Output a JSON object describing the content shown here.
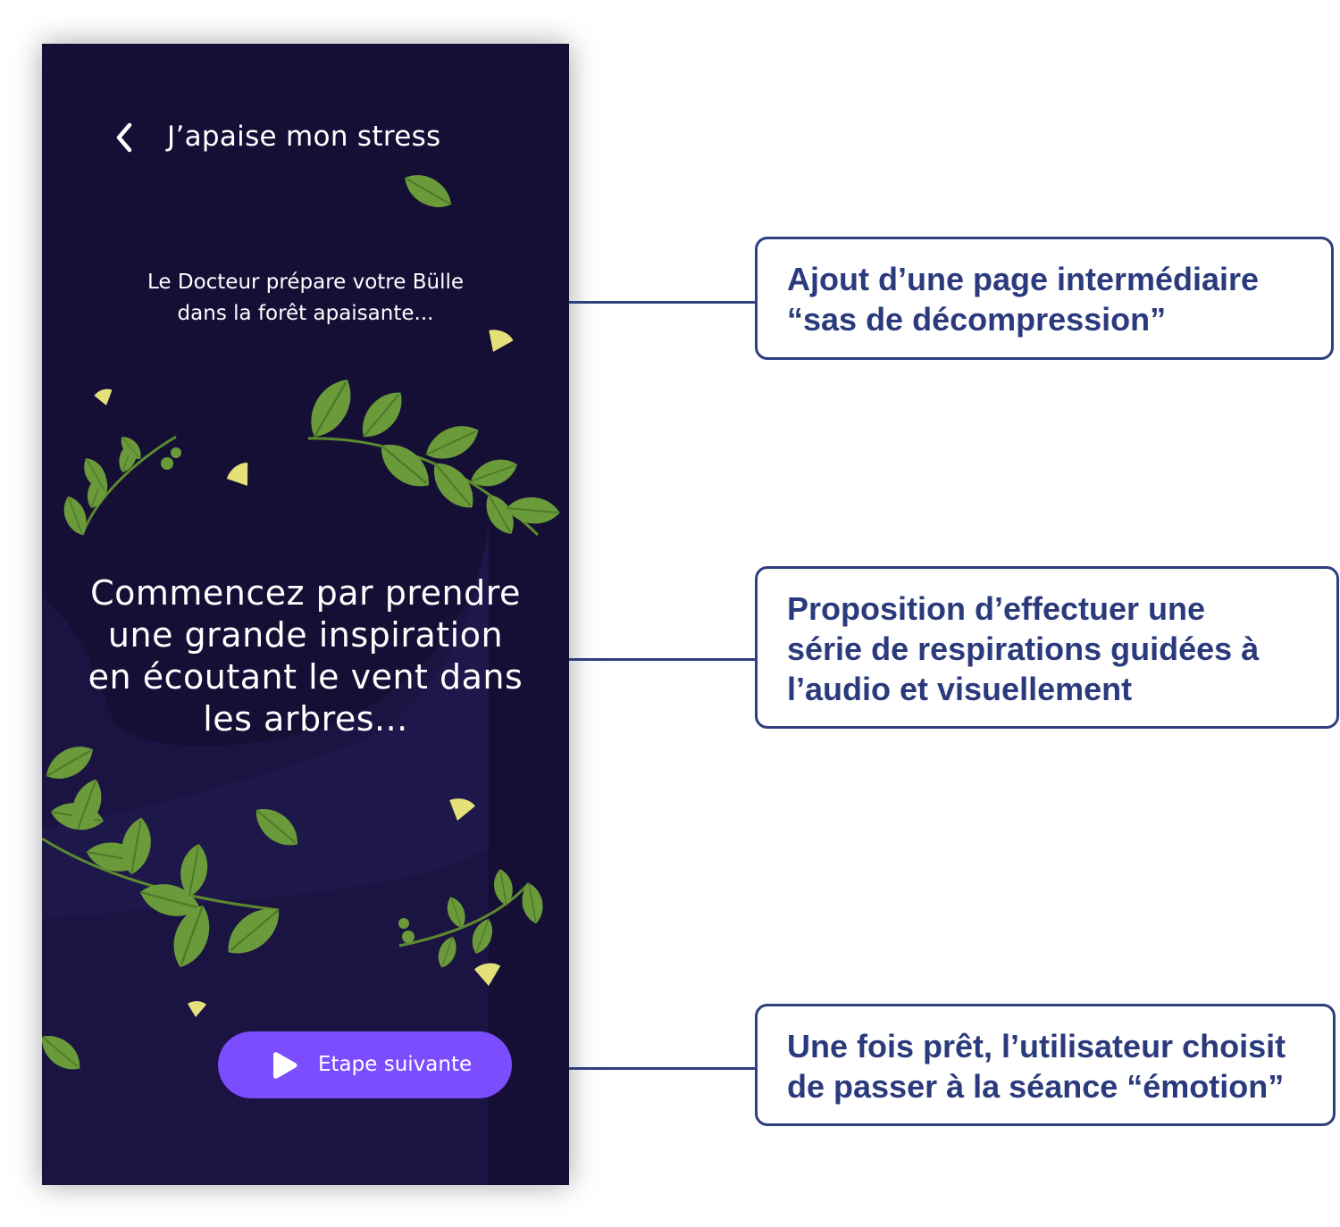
{
  "screen": {
    "title": "J’apaise mon stress",
    "subtitle_lines": [
      "Le Docteur prépare votre Bülle",
      "dans la forêt apaisante..."
    ],
    "instruction_lines": [
      "Commencez par prendre",
      "une grande inspiration",
      "en écoutant le vent dans",
      "les arbres..."
    ],
    "next_button_label": "Etape suivante",
    "icons": {
      "back": "chevron-left-icon",
      "play": "play-icon"
    }
  },
  "annotations": [
    {
      "lines": [
        "Ajout d’une page intermédiaire",
        "“sas de décompression”"
      ]
    },
    {
      "lines": [
        "Proposition d’effectuer une",
        "série de respirations guidées à",
        "l’audio et visuellement"
      ]
    },
    {
      "lines": [
        "Une fois prêt, l’utilisateur choisit",
        "de passer à la séance “émotion”"
      ]
    }
  ],
  "colors": {
    "screen_background": "#150f36",
    "button_background": "#7b4dff",
    "annotation_border": "#2e3e7f",
    "annotation_text": "#2b3a7c",
    "leaf_green": "#6a9a3a",
    "ginkgo_yellow": "#e4e07a"
  }
}
